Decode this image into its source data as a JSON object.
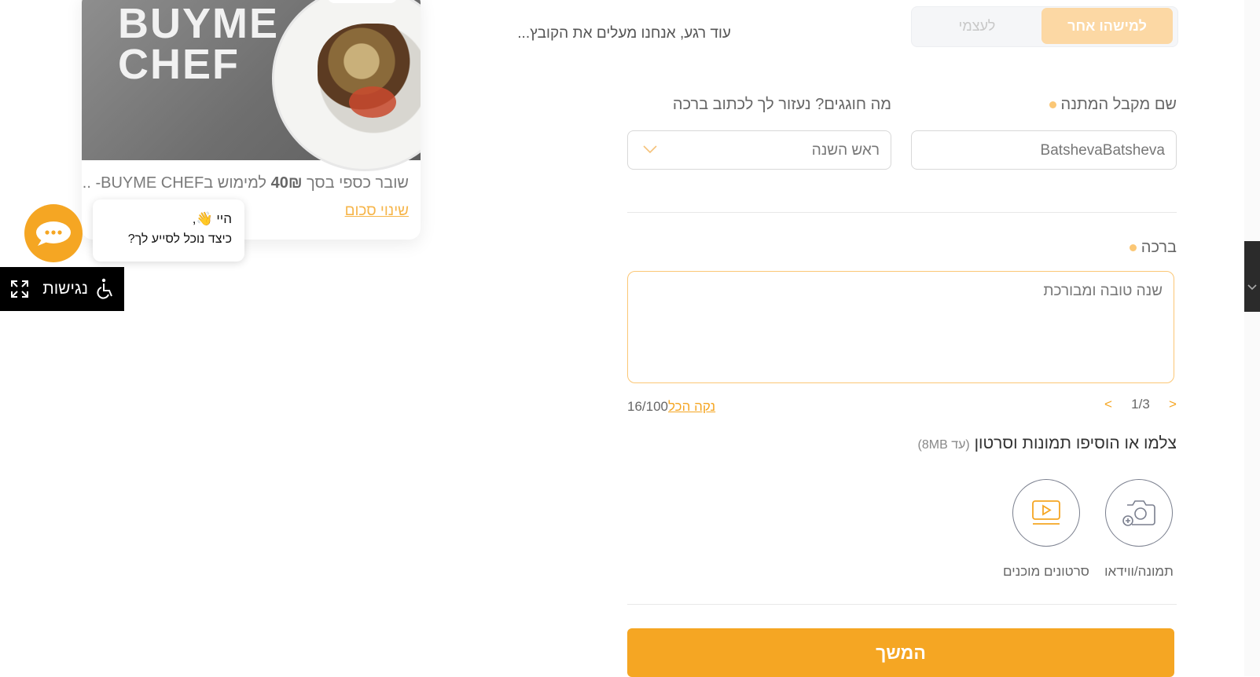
{
  "card": {
    "brand_line1": "BUYME",
    "brand_line2": "CHEF",
    "description_pre": "שובר כספי בסך ",
    "description_amount": "40₪",
    "description_post": " למימוש בBUYME CHEF- ...",
    "change_amount_link": "שינוי סכום"
  },
  "chat": {
    "icon": "chat-bubble-icon",
    "greeting_line1": "היי 👋,",
    "greeting_line2": "כיצד נוכל לסייע לך?"
  },
  "accessibility": {
    "label": "נגישות",
    "icon": "wheelchair-icon",
    "expand_icon": "expand-arrows-icon"
  },
  "loading_text": "עוד רגע, אנחנו מעלים את הקובץ...",
  "recipient_toggle": {
    "active": "למישהו אחר",
    "inactive": "לעצמי"
  },
  "form": {
    "recipient_label": "שם מקבל המתנה",
    "recipient_value": "BatshevaBatsheva",
    "occasion_label": "מה חוגגים? נעזור לך לכתוב ברכה",
    "occasion_value": "ראש השנה",
    "greeting_label": "ברכה",
    "greeting_value": "שנה טובה ומבורכת",
    "pager": {
      "prev": "<",
      "current": "1/3",
      "next": ">"
    },
    "clear_all": "נקה הכל",
    "char_counter": "16/100",
    "upload_title": "צלמו או הוסיפו תמונות וסרטון",
    "upload_hint": "(עד 8MB)",
    "photo_video_label": "תמונה/ווידאו",
    "ready_videos_label": "סרטונים מוכנים",
    "continue_button": "המשך"
  },
  "colors": {
    "accent": "#f5a623",
    "accent_light": "#fcd8a4",
    "required_dot": "#fbc775"
  }
}
